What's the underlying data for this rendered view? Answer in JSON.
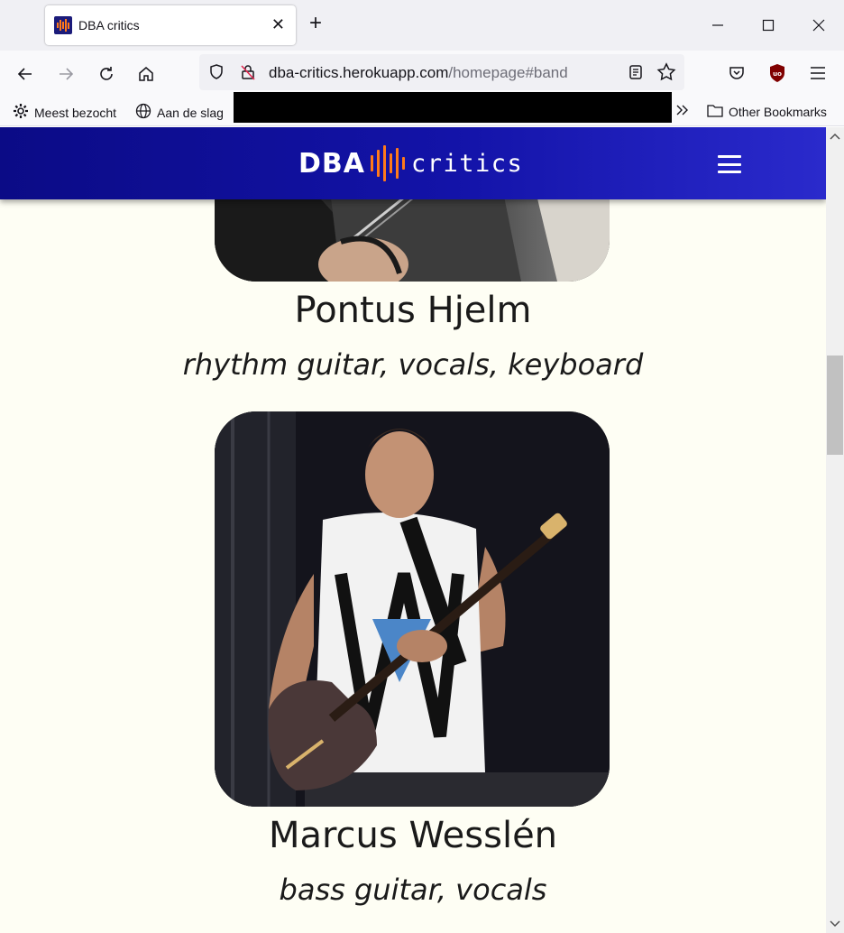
{
  "browser": {
    "tab_title": "DBA critics",
    "url_host": "dba-critics.herokuapp.com",
    "url_path": "/homepage#band",
    "bookmarks": [
      {
        "label": "Meest bezocht",
        "icon": "gear-icon"
      },
      {
        "label": "Aan de slag",
        "icon": "globe-icon"
      }
    ],
    "other_bookmarks": "Other Bookmarks"
  },
  "site": {
    "logo_left": "DBA",
    "logo_right": "critics",
    "accent_color": "#ff7a1a",
    "header_color": "#1313a8",
    "background_color": "#fefef4"
  },
  "band": {
    "members": [
      {
        "name": "Pontus Hjelm",
        "role": "rhythm guitar, vocals, keyboard"
      },
      {
        "name": "Marcus Wesslén",
        "role": "bass guitar, vocals"
      }
    ]
  }
}
